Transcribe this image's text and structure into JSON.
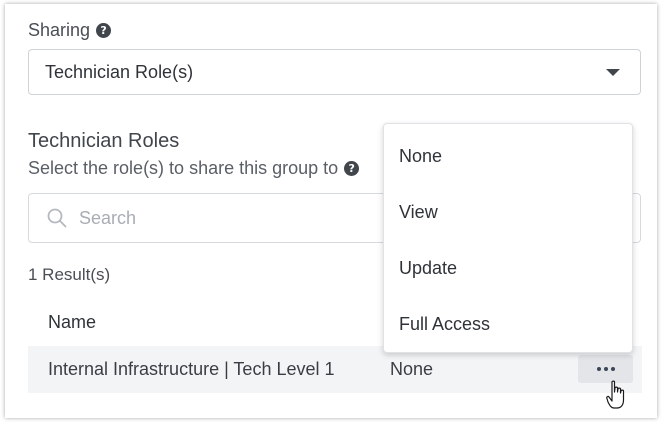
{
  "sharing": {
    "label": "Sharing",
    "help_glyph": "?",
    "selected_value": "Technician Role(s)"
  },
  "roles": {
    "title": "Technician Roles",
    "subtitle": "Select the role(s) to share this group to",
    "help_glyph": "?",
    "search_placeholder": "Search",
    "result_count": "1 Result(s)",
    "column_name": "Name",
    "rows": [
      {
        "name": "Internal Infrastructure | Tech Level 1",
        "access": "None"
      }
    ]
  },
  "access_menu": {
    "items": [
      "None",
      "View",
      "Update",
      "Full Access"
    ]
  },
  "icons": {
    "help": "help-circle-icon",
    "dropdown": "caret-down-icon",
    "search": "search-icon",
    "more": "more-horizontal-icon",
    "cursor": "hand-pointer-icon"
  },
  "colors": {
    "text": "#3f434a",
    "border": "#cfd3d8",
    "row_bg": "#f3f4f6",
    "button_bg": "#e3e5e8"
  }
}
